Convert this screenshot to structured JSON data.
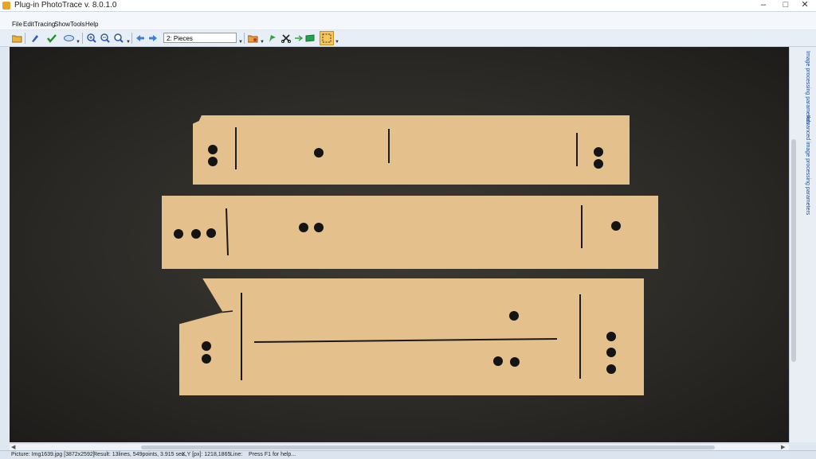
{
  "window": {
    "title": "Plug-in PhotoTrace v. 8.0.1.0",
    "min_icon": "minimize-icon",
    "max_icon": "maximize-icon",
    "close_icon": "close-icon"
  },
  "menu": [
    "File",
    "Edit",
    "Tracing",
    "Show",
    "Tools",
    "Help"
  ],
  "toolbar": {
    "layer_value": "2: Pieces",
    "icons": [
      "open-folder-icon",
      "pen-icon",
      "check-icon",
      "eye-icon",
      "zoom-in-icon",
      "zoom-out-icon",
      "zoom-fit-icon",
      "back-icon",
      "forward-icon",
      "folder-tools-icon",
      "green-flag-icon",
      "scissors-icon",
      "arrow-right-icon",
      "flag-icon",
      "select-rect-icon"
    ]
  },
  "side_panel": {
    "tab1": "Image processing parameters",
    "tab2": "Advanced image processing parameters"
  },
  "status": {
    "picture": "Picture: Img1639.jpg [3872x2592]",
    "result": "Result: 13lines, 549points, 3.915 sec.",
    "xy": "X,Y [px]: 1218,1865",
    "line": "Line:",
    "help": "Press F1 for help..."
  },
  "colors": {
    "background": "#2d2b27",
    "piece": "#e4c08c",
    "accent": "#f6c65b"
  }
}
